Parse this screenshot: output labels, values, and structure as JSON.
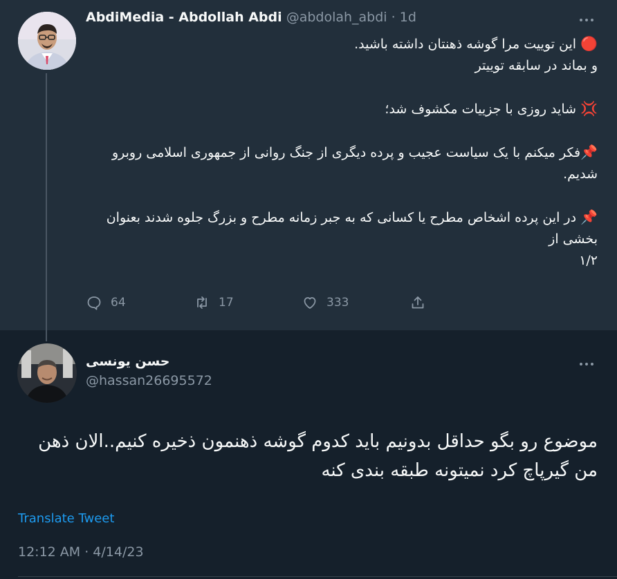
{
  "parent_tweet": {
    "author_name": "AbdiMedia - Abdollah Abdi",
    "handle": "@abdolah_abdi",
    "separator": "·",
    "date": "1d",
    "avatar": "person-avatar",
    "lines": [
      {
        "emoji": "🔴",
        "text": " این توییت مرا گوشه ذهنتان داشته باشید."
      },
      {
        "emoji": "",
        "text": "و بماند در سابقه توییتر"
      },
      {
        "emoji": "",
        "text": ""
      },
      {
        "emoji": "💢",
        "text": " شاید روزی با جزییات مکشوف شد؛"
      },
      {
        "emoji": "",
        "text": ""
      },
      {
        "emoji": "📌",
        "text": "فکر میکنم با یک سیاست عجیب و پرده دیگری از جنگ روانی از جمهوری اسلامی روبرو شدیم."
      },
      {
        "emoji": "",
        "text": ""
      },
      {
        "emoji": "📌",
        "text": " در این پرده اشخاص مطرح یا کسانی که به جبر زمانه مطرح و بزرگ جلوه شدند بعنوان بخشی از"
      },
      {
        "emoji": "",
        "text": "۱/۲"
      }
    ],
    "actions": {
      "reply_icon": "reply-icon",
      "reply_count": "64",
      "retweet_icon": "retweet-icon",
      "retweet_count": "17",
      "like_icon": "heart-icon",
      "like_count": "333",
      "share_icon": "share-icon"
    }
  },
  "reply_tweet": {
    "author_name": "حسن یونسی",
    "handle": "@hassan26695572",
    "avatar": "person-avatar",
    "body": "موضوع رو بگو حداقل بدونیم باید کدوم گوشه ذهنمون ذخیره کنیم..الان ذهن من گیرپاچ کرد نمیتونه طبقه بندی کنه",
    "translate_label": "Translate Tweet",
    "timestamp": "12:12 AM · 4/14/23"
  },
  "colors": {
    "parent_bg": "#222f3b",
    "page_bg": "#15202b",
    "muted": "#8b98a5",
    "link": "#1d9bf0",
    "text": "#f7f9f9"
  }
}
